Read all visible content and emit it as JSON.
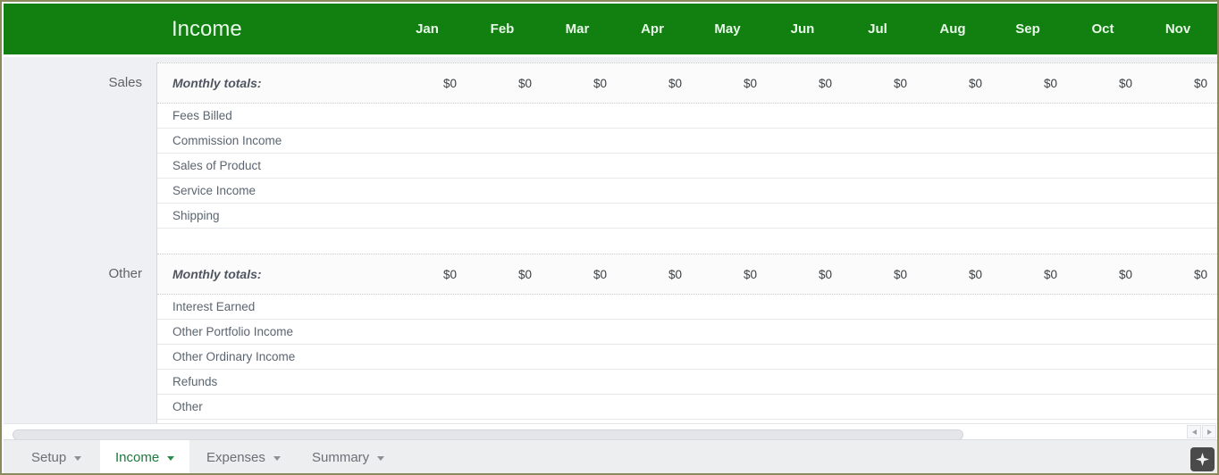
{
  "window": {
    "sheet_title": "Income"
  },
  "header": {
    "months": [
      "Jan",
      "Feb",
      "Mar",
      "Apr",
      "May",
      "Jun",
      "Jul",
      "Aug",
      "Sep",
      "Oct",
      "Nov"
    ]
  },
  "colors": {
    "header_green": "#118011",
    "active_tab_text": "#1a7a3c",
    "gutter_bg": "#eef0f3"
  },
  "sections": [
    {
      "group_label": "Sales",
      "totals_label": "Monthly totals:",
      "totals": [
        "$0",
        "$0",
        "$0",
        "$0",
        "$0",
        "$0",
        "$0",
        "$0",
        "$0",
        "$0",
        "$0"
      ],
      "items": [
        {
          "label": "Fees Billed",
          "values": [
            "",
            "",
            "",
            "",
            "",
            "",
            "",
            "",
            "",
            "",
            ""
          ]
        },
        {
          "label": "Commission Income",
          "values": [
            "",
            "",
            "",
            "",
            "",
            "",
            "",
            "",
            "",
            "",
            ""
          ]
        },
        {
          "label": "Sales of Product",
          "values": [
            "",
            "",
            "",
            "",
            "",
            "",
            "",
            "",
            "",
            "",
            ""
          ]
        },
        {
          "label": "Service Income",
          "values": [
            "",
            "",
            "",
            "",
            "",
            "",
            "",
            "",
            "",
            "",
            ""
          ]
        },
        {
          "label": "Shipping",
          "values": [
            "",
            "",
            "",
            "",
            "",
            "",
            "",
            "",
            "",
            "",
            ""
          ]
        }
      ]
    },
    {
      "group_label": "Other",
      "totals_label": "Monthly totals:",
      "totals": [
        "$0",
        "$0",
        "$0",
        "$0",
        "$0",
        "$0",
        "$0",
        "$0",
        "$0",
        "$0",
        "$0"
      ],
      "items": [
        {
          "label": "Interest Earned",
          "values": [
            "",
            "",
            "",
            "",
            "",
            "",
            "",
            "",
            "",
            "",
            ""
          ]
        },
        {
          "label": "Other Portfolio Income",
          "values": [
            "",
            "",
            "",
            "",
            "",
            "",
            "",
            "",
            "",
            "",
            ""
          ]
        },
        {
          "label": "Other Ordinary Income",
          "values": [
            "",
            "",
            "",
            "",
            "",
            "",
            "",
            "",
            "",
            "",
            ""
          ]
        },
        {
          "label": "Refunds",
          "values": [
            "",
            "",
            "",
            "",
            "",
            "",
            "",
            "",
            "",
            "",
            ""
          ]
        },
        {
          "label": "Other",
          "values": [
            "",
            "",
            "",
            "",
            "",
            "",
            "",
            "",
            "",
            "",
            ""
          ]
        }
      ]
    }
  ],
  "tabs": [
    {
      "label": "Setup",
      "active": false
    },
    {
      "label": "Income",
      "active": true
    },
    {
      "label": "Expenses",
      "active": false
    },
    {
      "label": "Summary",
      "active": false
    }
  ],
  "scrollbar": {
    "left_arrow_icon": "triangle-left-icon",
    "right_arrow_icon": "triangle-right-icon"
  },
  "corner_badge": {
    "icon": "sparkle-star-icon"
  }
}
